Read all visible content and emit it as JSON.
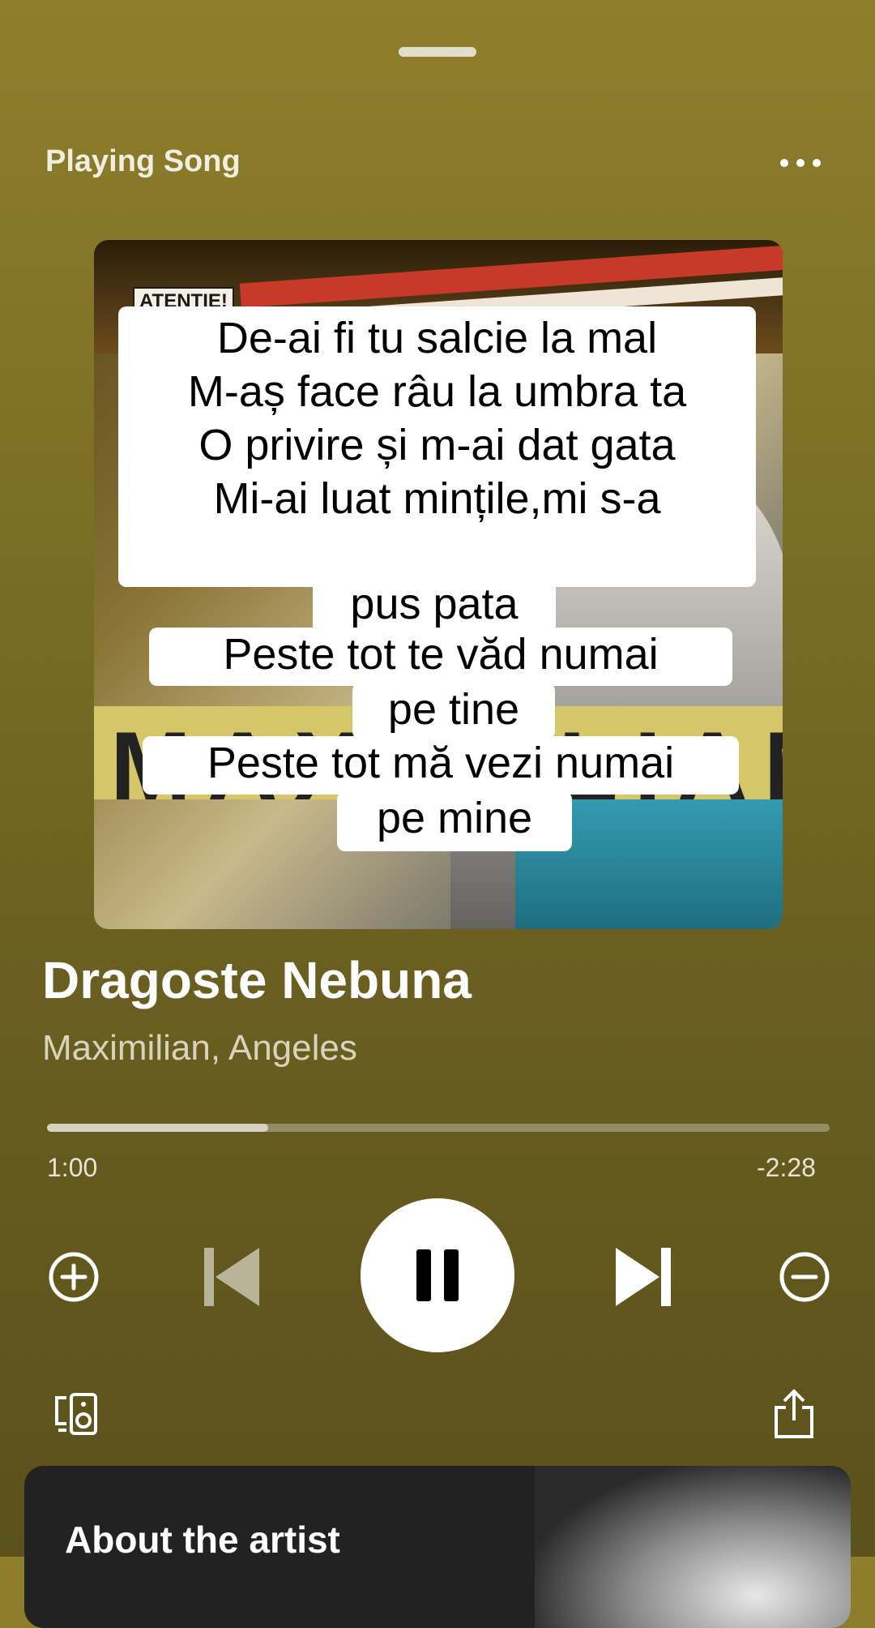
{
  "header": {
    "title": "Playing Song",
    "more_icon": "more-horizontal-icon"
  },
  "album_art": {
    "badge_text": "ATENTIE!",
    "band_text": "MAXIMILIAN"
  },
  "lyrics": {
    "block1": [
      "De-ai fi tu salcie  la mal",
      "M-aș face râu la umbra ta",
      "O privire și m-ai dat gata",
      "Mi-ai luat mințile,mi s-a"
    ],
    "block2": "pus pata",
    "block3": "Peste tot te văd numai",
    "block4": "pe tine",
    "block5": "Peste tot mă vezi numai",
    "block6": "pe mine"
  },
  "track": {
    "title": "Dragoste Nebuna",
    "artist": "Maximilian, Angeles"
  },
  "playback": {
    "elapsed": "1:00",
    "remaining": "-2:28",
    "progress_fraction": 0.283
  },
  "controls": {
    "add_icon": "plus-circle-icon",
    "previous_icon": "skip-back-icon",
    "play_pause_icon": "pause-icon",
    "next_icon": "skip-forward-icon",
    "remove_icon": "minus-circle-icon",
    "device_icon": "connect-device-icon",
    "share_icon": "share-icon"
  },
  "about": {
    "title": "About the artist"
  },
  "colors": {
    "background_top": "#8f7f2c",
    "background_bottom": "#5a511c",
    "card": "#222222"
  }
}
